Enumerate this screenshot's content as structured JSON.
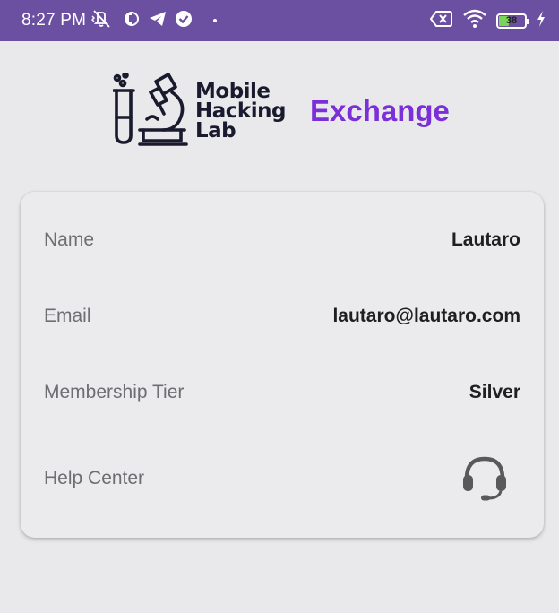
{
  "status_bar": {
    "time": "8:27 PM",
    "battery_level": "38",
    "battery_fraction": 0.38,
    "icons_left": [
      "mute-vibrate-icon",
      "data-saver-icon",
      "telegram-icon",
      "check-circle-icon",
      "notification-dot-icon"
    ],
    "icons_right": [
      "no-sim-icon",
      "wifi-icon",
      "battery-icon",
      "charging-icon"
    ]
  },
  "brand": {
    "logo_line1": "Mobile",
    "logo_line2": "Hacking",
    "logo_line3": "Lab",
    "app_name": "Exchange",
    "app_name_color": "#7b2fd8"
  },
  "profile": {
    "name_label": "Name",
    "name_value": "Lautaro",
    "email_label": "Email",
    "email_value": "lautaro@lautaro.com",
    "tier_label": "Membership Tier",
    "tier_value": "Silver",
    "help_label": "Help Center",
    "help_icon": "headset-icon"
  },
  "colors": {
    "status_bar": "#6b4fa0",
    "background": "#e9e9eb"
  }
}
